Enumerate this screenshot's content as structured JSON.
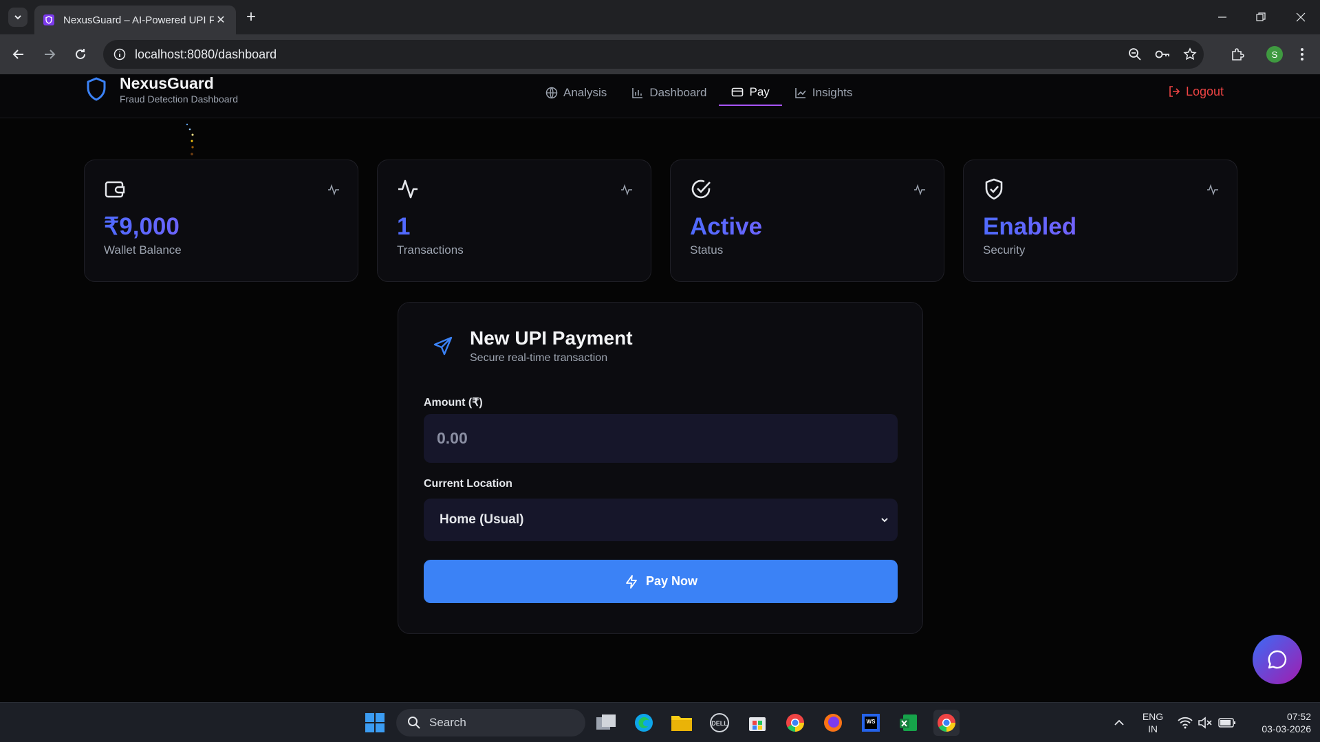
{
  "browser": {
    "tab_title": "NexusGuard – AI-Powered UPI F",
    "url": "localhost:8080/dashboard",
    "profile_initial": "S"
  },
  "app": {
    "brand_name": "NexusGuard",
    "brand_subtitle": "Fraud Detection Dashboard",
    "nav": [
      {
        "label": "Analysis",
        "icon": "globe-icon"
      },
      {
        "label": "Dashboard",
        "icon": "bar-chart-icon"
      },
      {
        "label": "Pay",
        "icon": "credit-card-icon",
        "active": true
      },
      {
        "label": "Insights",
        "icon": "line-chart-icon"
      }
    ],
    "logout_label": "Logout"
  },
  "stats": [
    {
      "value": "₹9,000",
      "label": "Wallet Balance",
      "icon": "wallet-icon"
    },
    {
      "value": "1",
      "label": "Transactions",
      "icon": "activity-icon"
    },
    {
      "value": "Active",
      "label": "Status",
      "icon": "check-circle-icon"
    },
    {
      "value": "Enabled",
      "label": "Security",
      "icon": "shield-check-icon"
    }
  ],
  "payment": {
    "title": "New UPI Payment",
    "subtitle": "Secure real-time transaction",
    "amount_label": "Amount (₹)",
    "amount_placeholder": "0.00",
    "location_label": "Current Location",
    "location_value": "Home (Usual)",
    "pay_button": "Pay Now"
  },
  "taskbar": {
    "search_label": "Search",
    "lang_line1": "ENG",
    "lang_line2": "IN",
    "time": "07:52",
    "date": "03-03-2026"
  },
  "colors": {
    "accent_blue": "#3b82f6",
    "accent_purple": "#a855f7",
    "logout_red": "#ef4444"
  }
}
